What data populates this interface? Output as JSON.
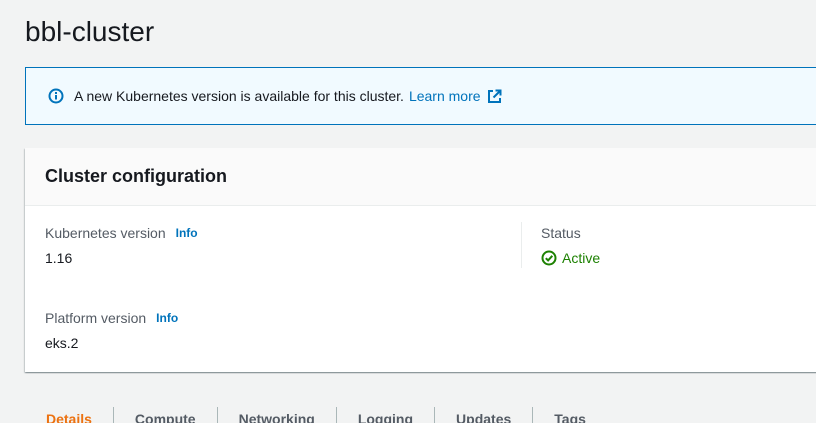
{
  "page": {
    "title": "bbl-cluster"
  },
  "flash": {
    "message": "A new Kubernetes version is available for this cluster.",
    "link_label": "Learn more",
    "icon": "info-icon",
    "link_icon": "external-link-icon"
  },
  "cluster_config": {
    "title": "Cluster configuration",
    "kubernetes_version": {
      "label": "Kubernetes version",
      "info_label": "Info",
      "value": "1.16"
    },
    "status": {
      "label": "Status",
      "value": "Active",
      "icon": "check-circle-icon"
    },
    "platform_version": {
      "label": "Platform version",
      "info_label": "Info",
      "value": "eks.2"
    }
  },
  "tabs": [
    {
      "label": "Details",
      "active": true
    },
    {
      "label": "Compute",
      "active": false
    },
    {
      "label": "Networking",
      "active": false
    },
    {
      "label": "Logging",
      "active": false
    },
    {
      "label": "Updates",
      "active": false
    },
    {
      "label": "Tags",
      "active": false
    }
  ],
  "colors": {
    "accent": "#0073bb",
    "success": "#1d8102",
    "active_tab": "#ec7211"
  }
}
